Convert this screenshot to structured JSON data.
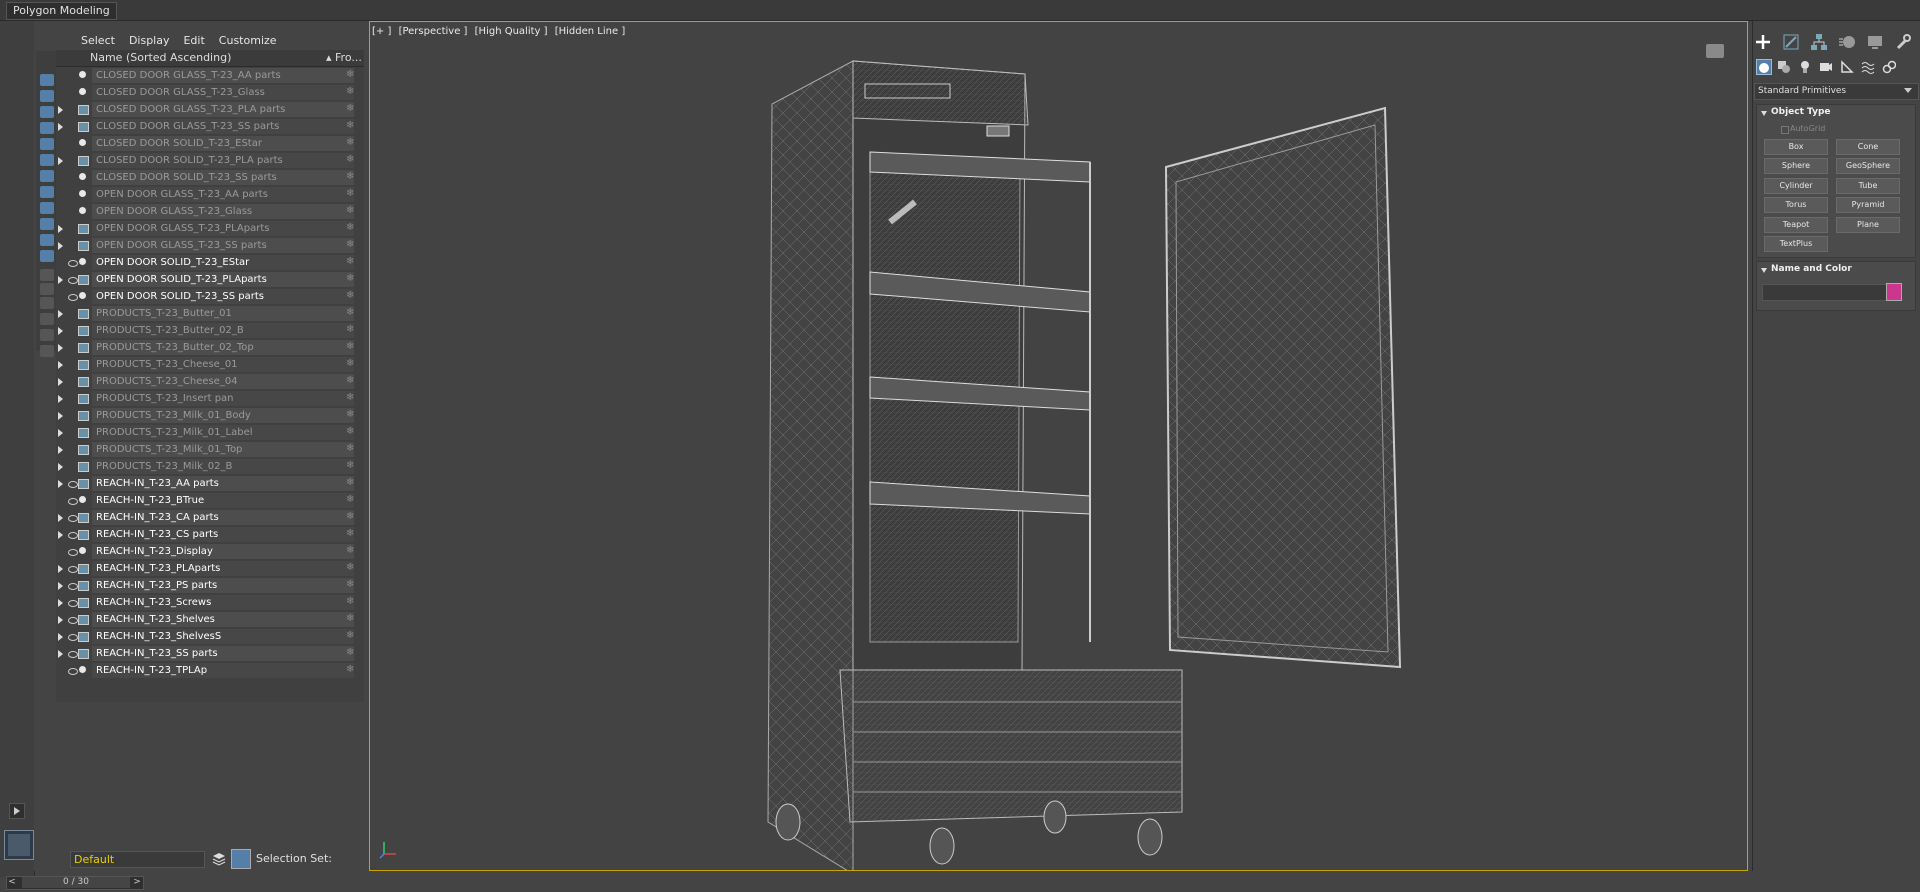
{
  "ribbon": {
    "tab_label": "Polygon Modeling"
  },
  "explorer": {
    "menu": [
      "Select",
      "Display",
      "Edit",
      "Customize"
    ],
    "header": {
      "name_col": "Name (Sorted Ascending)",
      "frozen_col": "▴ Fro..."
    },
    "rows": [
      {
        "label": "CLOSED DOOR GLASS_T-23_AA parts",
        "state": "dim",
        "expand": false,
        "kind": "obj"
      },
      {
        "label": "CLOSED DOOR GLASS_T-23_Glass",
        "state": "dim",
        "expand": false,
        "kind": "obj"
      },
      {
        "label": "CLOSED DOOR GLASS_T-23_PLA parts",
        "state": "dim",
        "expand": true,
        "kind": "grp"
      },
      {
        "label": "CLOSED DOOR GLASS_T-23_SS parts",
        "state": "dim",
        "expand": true,
        "kind": "grp"
      },
      {
        "label": "CLOSED DOOR SOLID_T-23_EStar",
        "state": "dim",
        "expand": false,
        "kind": "obj"
      },
      {
        "label": "CLOSED DOOR SOLID_T-23_PLA parts",
        "state": "dim",
        "expand": true,
        "kind": "grp"
      },
      {
        "label": "CLOSED DOOR SOLID_T-23_SS parts",
        "state": "dim",
        "expand": false,
        "kind": "obj"
      },
      {
        "label": "OPEN DOOR GLASS_T-23_AA parts",
        "state": "dim",
        "expand": false,
        "kind": "obj"
      },
      {
        "label": "OPEN DOOR GLASS_T-23_Glass",
        "state": "dim",
        "expand": false,
        "kind": "obj"
      },
      {
        "label": "OPEN DOOR GLASS_T-23_PLAparts",
        "state": "dim",
        "expand": true,
        "kind": "grp"
      },
      {
        "label": "OPEN DOOR GLASS_T-23_SS parts",
        "state": "dim",
        "expand": true,
        "kind": "grp"
      },
      {
        "label": "OPEN DOOR SOLID_T-23_EStar",
        "state": "bright",
        "expand": false,
        "kind": "obj"
      },
      {
        "label": "OPEN DOOR SOLID_T-23_PLAparts",
        "state": "bright",
        "expand": true,
        "kind": "grp"
      },
      {
        "label": "OPEN DOOR SOLID_T-23_SS parts",
        "state": "bright",
        "expand": false,
        "kind": "obj"
      },
      {
        "label": "PRODUCTS_T-23_Butter_01",
        "state": "dim",
        "expand": true,
        "kind": "grp"
      },
      {
        "label": "PRODUCTS_T-23_Butter_02_B",
        "state": "dim",
        "expand": true,
        "kind": "grp"
      },
      {
        "label": "PRODUCTS_T-23_Butter_02_Top",
        "state": "dim",
        "expand": true,
        "kind": "grp"
      },
      {
        "label": "PRODUCTS_T-23_Cheese_01",
        "state": "dim",
        "expand": true,
        "kind": "grp"
      },
      {
        "label": "PRODUCTS_T-23_Cheese_04",
        "state": "dim",
        "expand": true,
        "kind": "grp"
      },
      {
        "label": "PRODUCTS_T-23_Insert pan",
        "state": "dim",
        "expand": true,
        "kind": "grp"
      },
      {
        "label": "PRODUCTS_T-23_Milk_01_Body",
        "state": "dim",
        "expand": true,
        "kind": "grp"
      },
      {
        "label": "PRODUCTS_T-23_Milk_01_Label",
        "state": "dim",
        "expand": true,
        "kind": "grp"
      },
      {
        "label": "PRODUCTS_T-23_Milk_01_Top",
        "state": "dim",
        "expand": true,
        "kind": "grp"
      },
      {
        "label": "PRODUCTS_T-23_Milk_02_B",
        "state": "dim",
        "expand": true,
        "kind": "grp"
      },
      {
        "label": "REACH-IN_T-23_AA parts",
        "state": "bright",
        "expand": true,
        "kind": "grp"
      },
      {
        "label": "REACH-IN_T-23_BTrue",
        "state": "bright",
        "expand": false,
        "kind": "obj"
      },
      {
        "label": "REACH-IN_T-23_CA parts",
        "state": "bright",
        "expand": true,
        "kind": "grp"
      },
      {
        "label": "REACH-IN_T-23_CS parts",
        "state": "bright",
        "expand": true,
        "kind": "grp"
      },
      {
        "label": "REACH-IN_T-23_Display",
        "state": "bright",
        "expand": false,
        "kind": "obj"
      },
      {
        "label": "REACH-IN_T-23_PLAparts",
        "state": "bright",
        "expand": true,
        "kind": "grp"
      },
      {
        "label": "REACH-IN_T-23_PS parts",
        "state": "bright",
        "expand": true,
        "kind": "grp"
      },
      {
        "label": "REACH-IN_T-23_Screws",
        "state": "bright",
        "expand": true,
        "kind": "grp"
      },
      {
        "label": "REACH-IN_T-23_Shelves",
        "state": "bright",
        "expand": true,
        "kind": "grp"
      },
      {
        "label": "REACH-IN_T-23_ShelvesS",
        "state": "bright",
        "expand": true,
        "kind": "grp"
      },
      {
        "label": "REACH-IN_T-23_SS parts",
        "state": "bright",
        "expand": true,
        "kind": "grp"
      },
      {
        "label": "REACH-IN_T-23_TPLAp",
        "state": "bright",
        "expand": false,
        "kind": "obj"
      }
    ],
    "layer": "Default",
    "selection_set_label": "Selection Set:",
    "time": {
      "label": "0 / 30",
      "prev": "<",
      "next": ">"
    }
  },
  "viewport": {
    "labels": [
      "[+ ]",
      "[Perspective ]",
      "[High Quality ]",
      "[Hidden Line ]"
    ]
  },
  "command_panel": {
    "dropdown": "Standard Primitives",
    "object_type_title": "Object Type",
    "autogrid": "AutoGrid",
    "primitives": [
      "Box",
      "Cone",
      "Sphere",
      "GeoSphere",
      "Cylinder",
      "Tube",
      "Torus",
      "Pyramid",
      "Teapot",
      "Plane",
      "TextPlus"
    ],
    "name_color_title": "Name and Color",
    "object_color": "#c9378e"
  },
  "colors": {
    "viewport_border": "#c9a400",
    "accent": "#557fa8",
    "layer_text": "#e8d000"
  }
}
